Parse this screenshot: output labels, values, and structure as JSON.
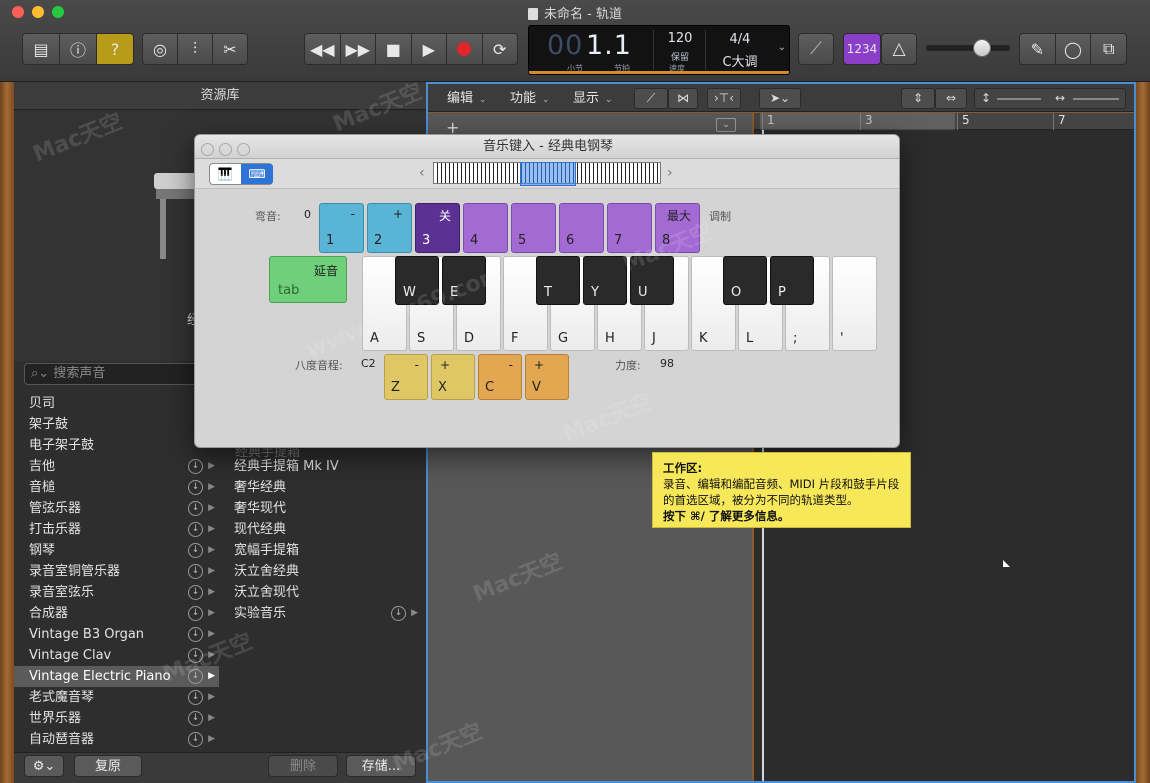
{
  "window": {
    "title": "未命名 - 轨道"
  },
  "lcd": {
    "bar_dim": "00",
    "bar": "1.1",
    "bar_label": "小节",
    "beat_label": "节拍",
    "tempo": "120",
    "tempo_label": "保留",
    "tempo_sublabel": "速度",
    "signature": "4/4",
    "key": "C大调"
  },
  "count_in": "1234",
  "library": {
    "title": "资源库",
    "search_placeholder": "搜索声音",
    "caption_fragment": "经",
    "categories": [
      "贝司",
      "架子鼓",
      "电子架子鼓",
      "吉他",
      "音槌",
      "管弦乐器",
      "打击乐器",
      "钢琴",
      "录音室铜管乐器",
      "录音室弦乐",
      "合成器",
      "Vintage B3 Organ",
      "Vintage Clav",
      "Vintage Electric Piano",
      "老式魔音琴",
      "世界乐器",
      "自动琶音器"
    ],
    "selected_index": 13,
    "subcategories": [
      "经典手提箱 Mk IV",
      "奢华经典",
      "奢华现代",
      "现代经典",
      "宽幅手提箱",
      "沃立舍经典",
      "沃立舍现代",
      "实验音乐"
    ],
    "hidden_fragment": "经典手提箱",
    "footer": {
      "revert": "复原",
      "delete": "删除",
      "save": "存储..."
    }
  },
  "tracks": {
    "menus": {
      "edit": "编辑",
      "functions": "功能",
      "view": "显示"
    },
    "ruler": [
      "1",
      "3",
      "5",
      "7"
    ]
  },
  "musical_typing": {
    "title": "音乐键入 - 经典电钢琴",
    "pitchbend_label": "弯音:",
    "pitchbend_value": "0",
    "pitch_keys": [
      {
        "top": "-",
        "bot": "1"
      },
      {
        "top": "+",
        "bot": "2"
      },
      {
        "top": "关",
        "bot": "3"
      },
      {
        "top": "",
        "bot": "4"
      },
      {
        "top": "",
        "bot": "5"
      },
      {
        "top": "",
        "bot": "6"
      },
      {
        "top": "",
        "bot": "7"
      },
      {
        "top": "最大",
        "bot": "8"
      }
    ],
    "modulation_label": "调制",
    "sustain_label": "延音",
    "sustain_key": "tab",
    "white_keys": [
      "A",
      "S",
      "D",
      "F",
      "G",
      "H",
      "J",
      "K",
      "L",
      ";",
      "'"
    ],
    "black_keys": [
      "W",
      "E",
      "T",
      "Y",
      "U",
      "O",
      "P"
    ],
    "octave_label": "八度音程:",
    "octave_value": "C2",
    "octave_keys": [
      {
        "top": "-",
        "bot": "Z"
      },
      {
        "top": "+",
        "bot": "X"
      }
    ],
    "velocity_keys": [
      {
        "top": "-",
        "bot": "C"
      },
      {
        "top": "+",
        "bot": "V"
      }
    ],
    "velocity_label": "力度:",
    "velocity_value": "98"
  },
  "tooltip": {
    "heading": "工作区:",
    "body": "录音、编辑和编配音频、MIDI 片段和鼓手片段的首选区域，被分为不同的轨道类型。",
    "hint": "按下 ⌘/ 了解更多信息。"
  },
  "watermark": {
    "brand": "Mac天空",
    "url": "www.mac69.com"
  },
  "colors": {
    "accent_blue": "#4a8fd6",
    "record_red": "#e0252b",
    "tooltip_yellow": "#f7e85a",
    "count_in_purple": "#8b3fc8"
  }
}
